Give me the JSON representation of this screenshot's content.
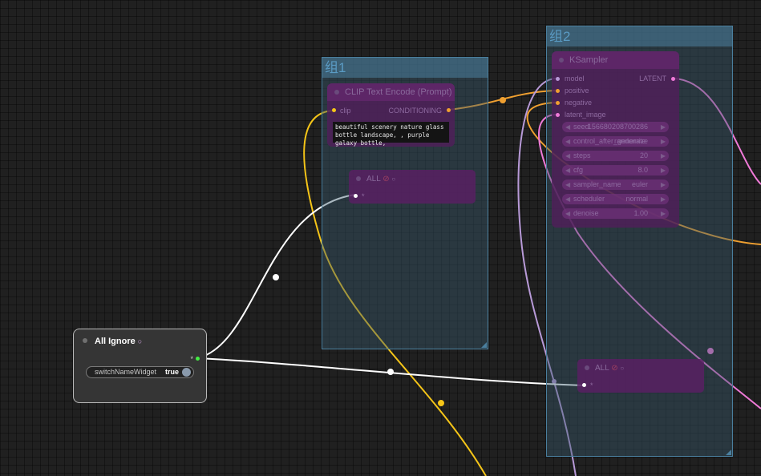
{
  "groups": [
    {
      "title": "组1"
    },
    {
      "title": "组2"
    }
  ],
  "clip_node": {
    "title": "CLIP Text Encode (Prompt)",
    "input_label": "clip",
    "output_label": "CONDITIONING",
    "prompt_text": "beautiful scenery nature glass bottle landscape, , purple galaxy bottle,"
  },
  "ksampler": {
    "title": "KSampler",
    "inputs": [
      "model",
      "positive",
      "negative",
      "latent_image"
    ],
    "output_label": "LATENT",
    "widgets": [
      {
        "label": "seed",
        "value": "156680208700286"
      },
      {
        "label": "control_after_generate",
        "value": "randomize"
      },
      {
        "label": "steps",
        "value": "20"
      },
      {
        "label": "cfg",
        "value": "8.0"
      },
      {
        "label": "sampler_name",
        "value": "euler"
      },
      {
        "label": "scheduler",
        "value": "normal"
      },
      {
        "label": "denoise",
        "value": "1.00"
      }
    ]
  },
  "all_nodes": [
    {
      "title": "ALL",
      "input": "*"
    },
    {
      "title": "ALL",
      "input": "*"
    }
  ],
  "ignore_node": {
    "title": "All Ignore",
    "output_label": "*",
    "widget_label": "switchNameWidget",
    "widget_value": "true"
  },
  "colors": {
    "clip_wire": "#f5c518",
    "conditioning_wire": "#f0a030",
    "model_wire": "#b89ad8",
    "latent_wire": "#f07ad8",
    "switch_wire": "#ffffff",
    "group_border": "#4a7f9e"
  }
}
